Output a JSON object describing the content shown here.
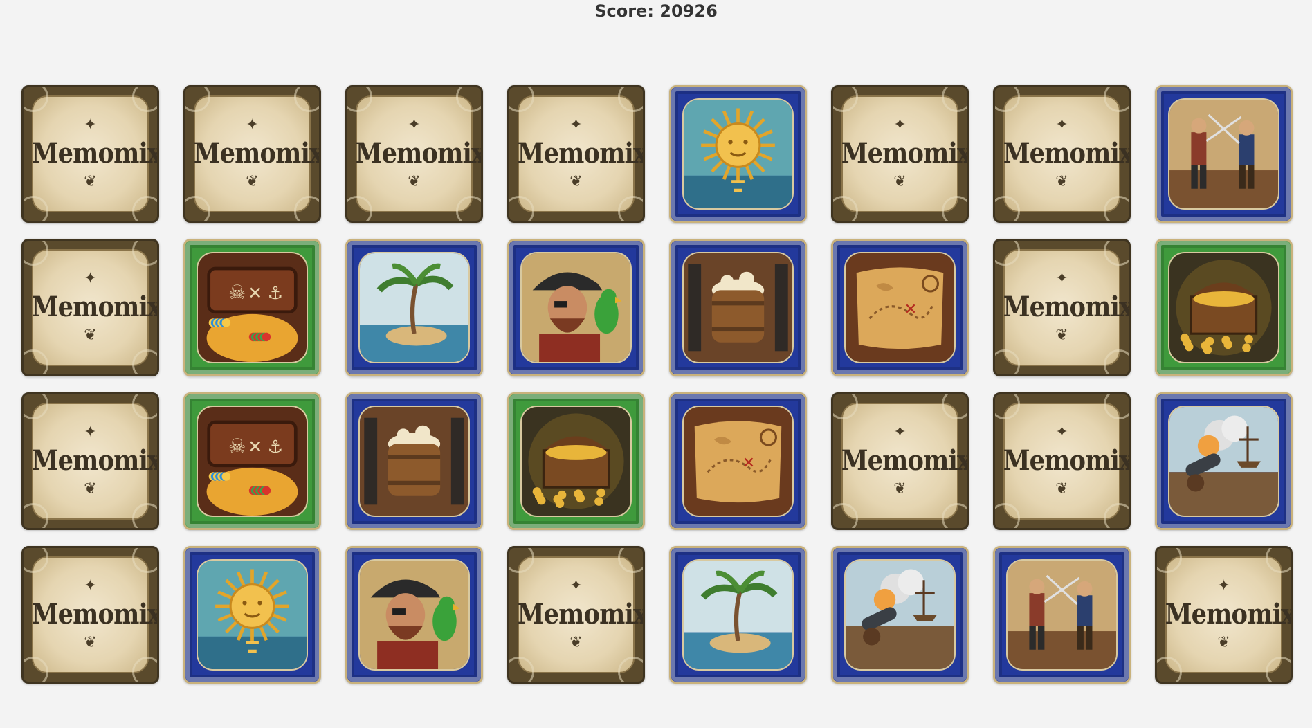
{
  "score_text": "Score: 20926",
  "back_logo": "Memomix",
  "colors": {
    "background": "#f3f3f3",
    "back_card": "#5a4a2c",
    "face_blue": "#23399c",
    "face_green": "#3f9a3c"
  },
  "cards": [
    {
      "state": "hidden"
    },
    {
      "state": "hidden"
    },
    {
      "state": "hidden"
    },
    {
      "state": "hidden"
    },
    {
      "state": "revealed",
      "image": "sun",
      "frame": "blue"
    },
    {
      "state": "hidden"
    },
    {
      "state": "hidden"
    },
    {
      "state": "revealed",
      "image": "sword-duel",
      "frame": "blue"
    },
    {
      "state": "hidden"
    },
    {
      "state": "revealed",
      "image": "treasure-hoard",
      "frame": "green"
    },
    {
      "state": "revealed",
      "image": "palm-island",
      "frame": "blue"
    },
    {
      "state": "revealed",
      "image": "pirate-with-parrot",
      "frame": "blue"
    },
    {
      "state": "revealed",
      "image": "rum-barrel",
      "frame": "blue"
    },
    {
      "state": "revealed",
      "image": "treasure-map",
      "frame": "blue"
    },
    {
      "state": "hidden"
    },
    {
      "state": "revealed",
      "image": "treasure-chest",
      "frame": "green"
    },
    {
      "state": "hidden"
    },
    {
      "state": "revealed",
      "image": "treasure-hoard",
      "frame": "green"
    },
    {
      "state": "revealed",
      "image": "rum-barrel",
      "frame": "blue"
    },
    {
      "state": "revealed",
      "image": "treasure-chest",
      "frame": "green"
    },
    {
      "state": "revealed",
      "image": "treasure-map",
      "frame": "blue"
    },
    {
      "state": "hidden"
    },
    {
      "state": "hidden"
    },
    {
      "state": "revealed",
      "image": "cannon-fire",
      "frame": "blue"
    },
    {
      "state": "hidden"
    },
    {
      "state": "revealed",
      "image": "sun",
      "frame": "blue"
    },
    {
      "state": "revealed",
      "image": "pirate-with-parrot",
      "frame": "blue"
    },
    {
      "state": "hidden"
    },
    {
      "state": "revealed",
      "image": "palm-island",
      "frame": "blue"
    },
    {
      "state": "revealed",
      "image": "cannon-fire",
      "frame": "blue"
    },
    {
      "state": "revealed",
      "image": "sword-duel",
      "frame": "blue"
    },
    {
      "state": "hidden"
    }
  ]
}
